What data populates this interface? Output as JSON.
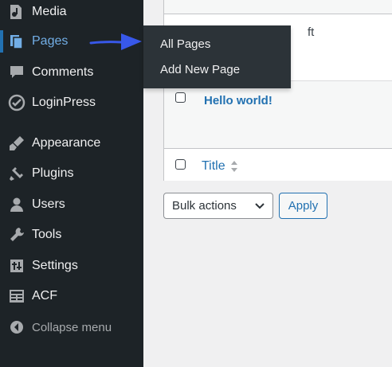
{
  "sidebar": {
    "items": [
      {
        "label": "Media",
        "icon": "media-icon"
      },
      {
        "label": "Pages",
        "icon": "pages-icon",
        "current": true
      },
      {
        "label": "Comments",
        "icon": "comments-icon"
      },
      {
        "label": "LoginPress",
        "icon": "loginpress-icon"
      },
      {
        "label": "Appearance",
        "icon": "appearance-icon"
      },
      {
        "label": "Plugins",
        "icon": "plugins-icon"
      },
      {
        "label": "Users",
        "icon": "users-icon"
      },
      {
        "label": "Tools",
        "icon": "tools-icon"
      },
      {
        "label": "Settings",
        "icon": "settings-icon"
      },
      {
        "label": "ACF",
        "icon": "acf-icon"
      }
    ],
    "collapse_label": "Collapse menu"
  },
  "flyout": {
    "items": [
      "All Pages",
      "Add New Page"
    ]
  },
  "table": {
    "draft_fragment": "ft",
    "row_title": "Hello world!",
    "footer_column": "Title"
  },
  "bulk": {
    "selected": "Bulk actions",
    "apply_label": "Apply"
  },
  "colors": {
    "sidebar_bg": "#1d2327",
    "flyout_bg": "#2c3338",
    "accent": "#2271b1",
    "current_text": "#72aee6",
    "arrow": "#3858e9"
  }
}
